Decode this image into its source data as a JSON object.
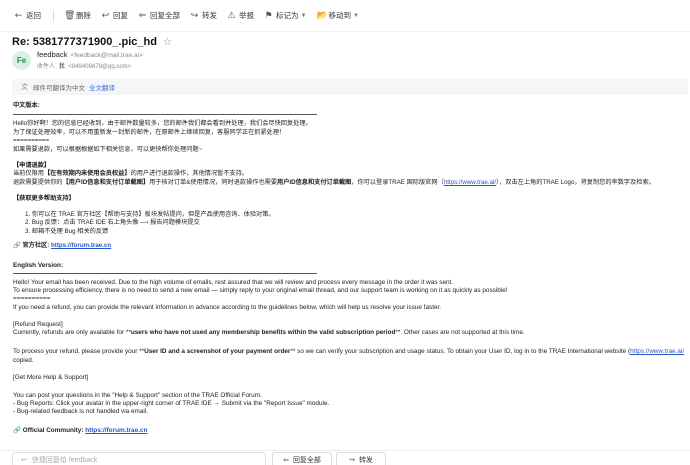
{
  "toolbar": {
    "back": "返回",
    "delete": "删除",
    "reply": "回复",
    "reply_all": "回复全部",
    "forward": "转发",
    "report": "举报",
    "mark": "标记为",
    "move": "移动到"
  },
  "email": {
    "subject": "Re: 5381777371900_.pic_hd",
    "sender_name": "feedback",
    "sender_addr": "<feedback@mail.trae.ai>",
    "avatar_text": "Fe",
    "recipient_label": "收件人",
    "recipient_me": "我",
    "recipient_addr": "<849409478@qq.com>"
  },
  "translate": {
    "text": "邮件可翻译为中文",
    "link": "全文翻译"
  },
  "body": {
    "cn_title": "中文版本:",
    "cn_l1": "Hello你好啊！您的信息已经收到，由于邮件数量较多，您的邮件我们都会看到并处理，我们会尽快回复处理。",
    "cn_l2": "为了保证处理效率，可以不用重新发一封新的邮件，在原邮件上继续回复，客服同学正在抓紧处理！",
    "sep1": "==========",
    "cn_l3": "如果需要退款，可以根据根据如下相关信息，可以更快帮你处理问题~",
    "cn_refund_title": "【申请退款】",
    "cn_r1_a": "当前仅限用",
    "cn_r1_b": "【在有效期内未使用会员权益】",
    "cn_r1_c": "的用户进行退款操作，其他情况暂不支持。",
    "cn_r2_a": "退款需要提供你的",
    "cn_r2_b": "【用户ID信息和支付订单截图】",
    "cn_r2_c": "用于核对订单&使用情况，同时退款操作也需要",
    "cn_r2_d": "用户ID信息和支付订单截图",
    "cn_r2_e": "，你可以登录TRAE 国际版官网（",
    "cn_r2_link": "https://www.trae.ai/",
    "cn_r2_f": "），双击左上角的TRAE Logo，将复制您的率数字及检索。",
    "cn_help_title": "【获取更多帮助支持】",
    "cn_h1": "1. 你可以在 TRAE 官方社区【帮助与支持】板块发帖提问，但是产品使用咨询、体验对策。",
    "cn_h2": "2. Bug 反馈：点击 TRAE IDE 右上角头像 —› 报告问题模块提交",
    "cn_h3": "3. 邮箱不处理 Bug 相关的反馈",
    "cn_forum_label": "官方社区:",
    "cn_forum_link": "https://forum.trae.cn",
    "en_title": "English  Version:",
    "en_l1": "Hello! Your email has been received. Due to the high volume of emails, rest assured that we will review and process every message in the order it was sent.",
    "en_l2": "To ensure processing efficiency, there is no need to send a new email — simply reply to your original email thread, and our support team is working on it as quickly as possible!",
    "sep2": "==========",
    "en_l3": "If you need a refund, you can provide the relevant information in advance according to the guidelines below, which will help us resolve your issue faster.",
    "en_refund_title": "[Refund Request]",
    "en_r1_a": "Currently, refunds are only available for **",
    "en_r1_b": "users who have not used any membership benefits within the valid subscription period",
    "en_r1_c": "**. Other cases are not supported at this time.",
    "en_r2_a": "To process your refund, please provide your **",
    "en_r2_b": "User ID and a screenshot of your payment order",
    "en_r2_c": "** so we can verify your subscription and usage status. To obtain your User ID, log in to the TRAE International website (",
    "en_r2_link": "https://www.trae.ai/",
    "en_r3": "copied.",
    "en_help_title": "[Get More Help & Support]",
    "en_h1": "You can post your questions in the \"Help & Support\" section of the TRAE Official Forum.",
    "en_h2": "- Bug Reports: Click your avatar in the upper-right corner of TRAE IDE → Submit via the \"Report Issue\" module.",
    "en_h3": "- Bug-related feedback is not handled via email.",
    "en_forum_label": "Official Community:",
    "en_forum_link": "https://forum.trae.cn"
  },
  "reply_bar": {
    "placeholder": "快捷回复给 feedback",
    "reply_all": "回复全部",
    "forward": "转发"
  }
}
